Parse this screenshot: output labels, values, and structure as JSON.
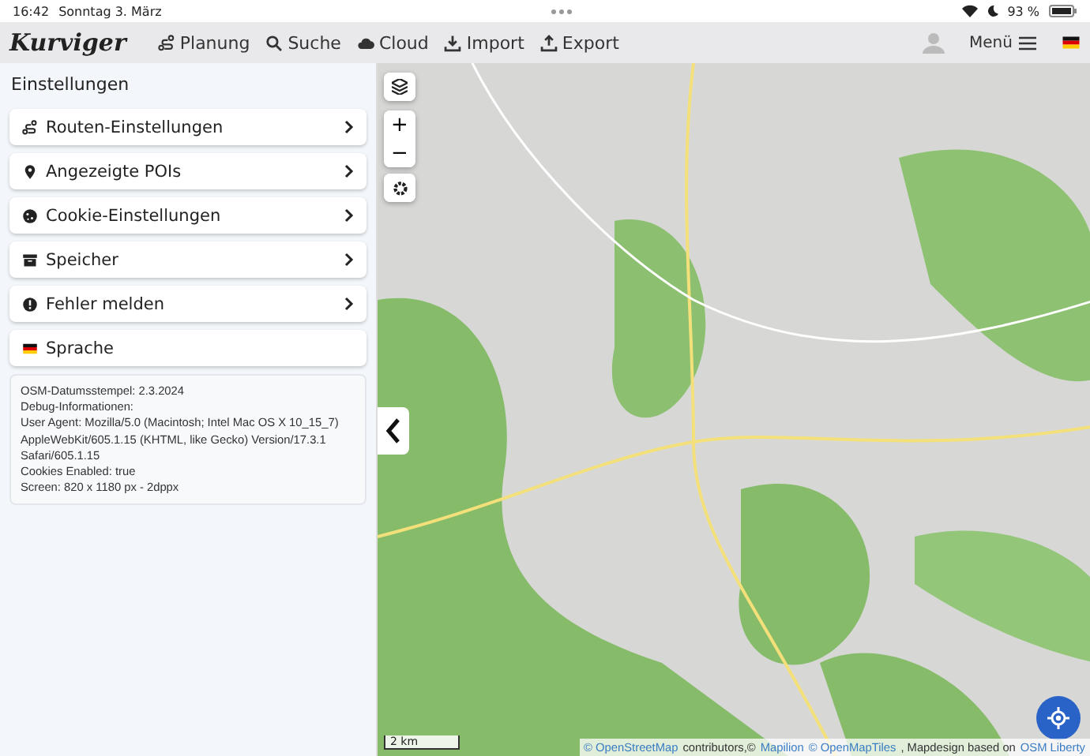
{
  "status_bar": {
    "time": "16:42",
    "date": "Sonntag 3. März",
    "battery": "93 %"
  },
  "nav": {
    "logo": "Kurviger",
    "items": [
      {
        "label": "Planung"
      },
      {
        "label": "Suche"
      },
      {
        "label": "Cloud"
      },
      {
        "label": "Import"
      },
      {
        "label": "Export"
      }
    ],
    "menu": "Menü"
  },
  "sidebar": {
    "title": "Einstellungen",
    "items": [
      {
        "label": "Routen-Einstellungen",
        "chevron": true
      },
      {
        "label": "Angezeigte POIs",
        "chevron": true
      },
      {
        "label": "Cookie-Einstellungen",
        "chevron": true
      },
      {
        "label": "Speicher",
        "chevron": true
      },
      {
        "label": "Fehler melden",
        "chevron": true
      },
      {
        "label": "Sprache",
        "chevron": false
      }
    ],
    "info": [
      "OSM-Datumsstempel: 2.3.2024",
      "Debug-Informationen:",
      "User Agent: Mozilla/5.0 (Macintosh; Intel Mac OS X 10_15_7) AppleWebKit/605.1.15 (KHTML, like Gecko) Version/17.3.1 Safari/605.1.15",
      "Cookies Enabled: true",
      "Screen: 820 x 1180 px - 2dppx"
    ]
  },
  "map": {
    "zoom_in": "+",
    "zoom_out": "−",
    "scale": "2 km",
    "attribution": [
      {
        "text": "© OpenStreetMap",
        "link": true
      },
      {
        "text": "contributors,©",
        "link": false
      },
      {
        "text": "Mapilion",
        "link": true
      },
      {
        "text": "© OpenMapTiles",
        "link": true
      },
      {
        "text": ", Mapdesign based on",
        "link": false
      },
      {
        "text": "OSM Liberty",
        "link": true
      }
    ]
  }
}
